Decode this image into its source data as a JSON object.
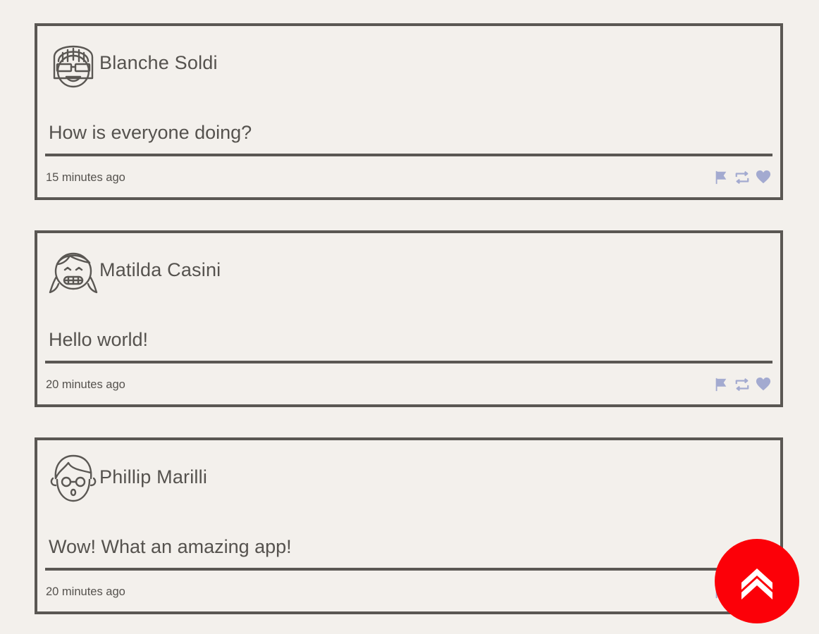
{
  "feed": {
    "tweets": [
      {
        "name": "Blanche Soldi",
        "text": "How is everyone doing?",
        "time": "15 minutes ago",
        "avatar": "girl-sunglasses-icon"
      },
      {
        "name": "Matilda Casini",
        "text": "Hello world!",
        "time": "20 minutes ago",
        "avatar": "girl-pigtails-icon"
      },
      {
        "name": "Phillip Marilli",
        "text": "Wow! What an amazing app!",
        "time": "20 minutes ago",
        "avatar": "boy-glasses-icon"
      }
    ]
  },
  "actions": {
    "icons": [
      "flag-icon",
      "retweet-icon",
      "heart-icon"
    ],
    "color": "#a3aad0"
  },
  "fab": {
    "icon": "double-chevron-up-icon",
    "color": "#fc0008"
  }
}
